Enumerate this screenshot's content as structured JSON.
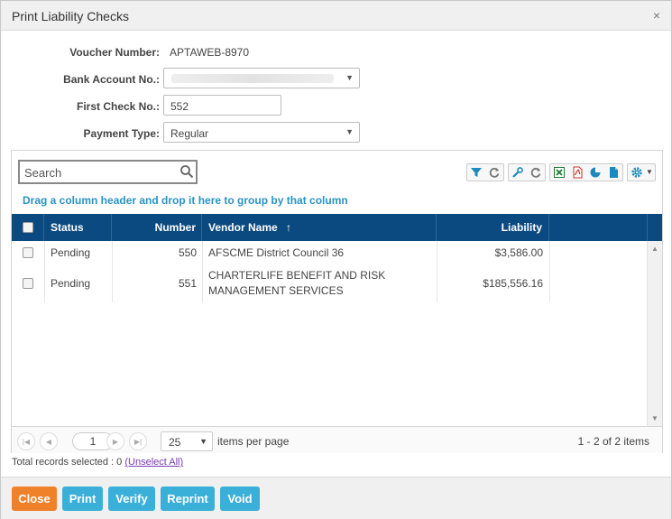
{
  "dialog": {
    "title": "Print Liability Checks",
    "close_glyph": "×"
  },
  "form": {
    "voucher_label": "Voucher Number:",
    "voucher_value": "APTAWEB-8970",
    "bank_label": "Bank Account No.:",
    "check_label": "First Check No.:",
    "check_value": "552",
    "payment_label": "Payment Type:",
    "payment_value": "Regular"
  },
  "grid": {
    "search_placeholder": "Search",
    "group_hint": "Drag a column header and drop it here to group by that column",
    "columns": {
      "status": "Status",
      "number": "Number",
      "vendor": "Vendor Name",
      "vendor_sort": "↑",
      "liability": "Liability"
    },
    "rows": [
      {
        "status": "Pending",
        "number": "550",
        "vendor_line1": "AFSCME District Council 36",
        "vendor_line2": "",
        "liability": "$3,586.00"
      },
      {
        "status": "Pending",
        "number": "551",
        "vendor_line1": "CHARTERLIFE BENEFIT AND RISK",
        "vendor_line2": "MANAGEMENT SERVICES",
        "liability": "$185,556.16"
      }
    ],
    "toolbar_icons": [
      "filter-icon",
      "refresh-icon",
      "wrench-icon",
      "refresh-icon",
      "excel-icon",
      "pdf-icon",
      "chart-icon",
      "document-icon",
      "gear-icon"
    ]
  },
  "pager": {
    "current_page": "1",
    "page_size": "25",
    "items_per_page": "items per page",
    "info": "1 - 2 of 2 items"
  },
  "selection": {
    "total_text": "Total records selected : 0",
    "unselect_link": "(Unselect All)"
  },
  "buttons": {
    "close": "Close",
    "print": "Print",
    "verify": "Verify",
    "reprint": "Reprint",
    "void": "Void"
  },
  "colors": {
    "header_bg": "#0b4a80",
    "link": "#2a93c2",
    "close_button": "#f0812b",
    "action_button": "#3aafd8"
  }
}
